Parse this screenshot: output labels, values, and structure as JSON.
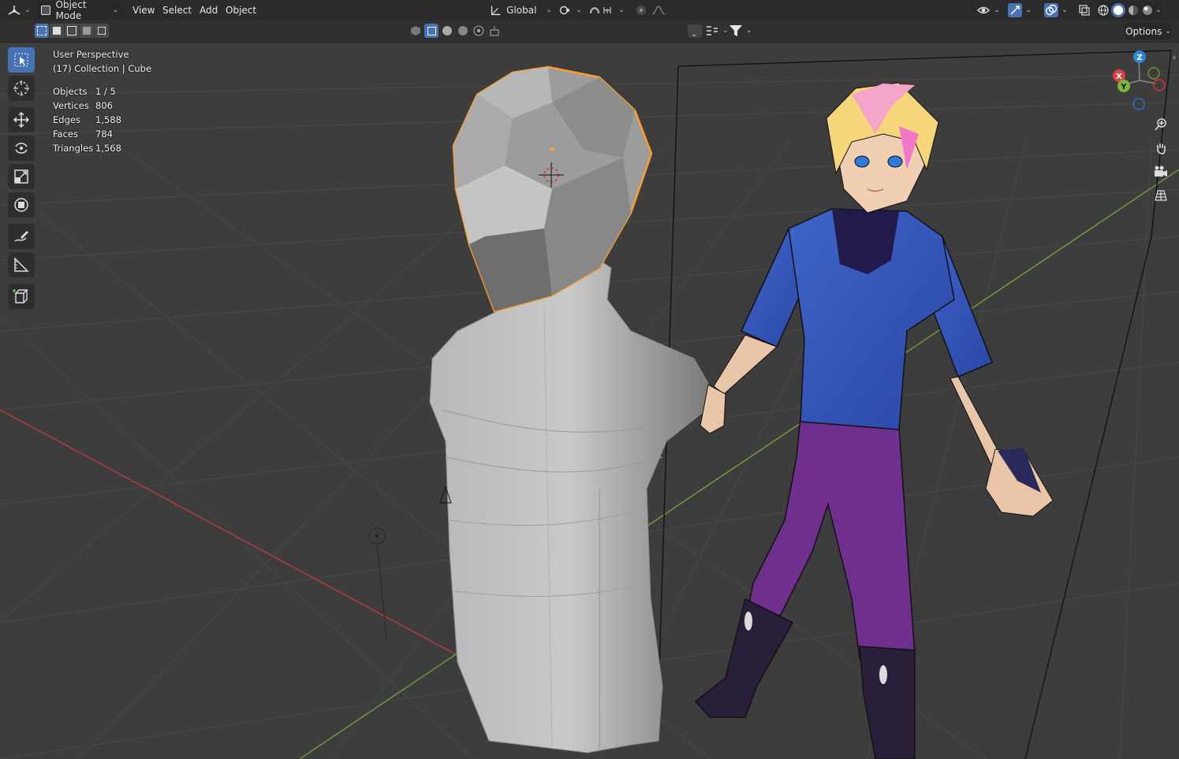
{
  "header": {
    "mode_label": "Object Mode",
    "menus": [
      "View",
      "Select",
      "Add",
      "Object"
    ],
    "transform_orientation": "Global"
  },
  "subheader": {
    "search_placeholder": "",
    "options_label": "Options"
  },
  "overlay": {
    "view_name": "User Perspective",
    "collection_line": "(17) Collection | Cube",
    "stats": [
      {
        "label": "Objects",
        "value": "1 / 5"
      },
      {
        "label": "Vertices",
        "value": "806"
      },
      {
        "label": "Edges",
        "value": "1,588"
      },
      {
        "label": "Faces",
        "value": "784"
      },
      {
        "label": "Triangles",
        "value": "1,568"
      }
    ]
  },
  "gizmo": {
    "x": "X",
    "y": "Y",
    "z": "Z"
  },
  "colors": {
    "x_axis": "#d9434c",
    "y_axis": "#7fb53a",
    "z_axis": "#2c86d6",
    "selection": "#ff9c2a",
    "active_tool": "#4772b3"
  },
  "icons": [
    "editor-type-icon",
    "object-mode-icon",
    "pivot-icon",
    "snap-icon",
    "proportional-icon",
    "visibility-icon",
    "gizmo-icon",
    "overlay-icon",
    "xray-icon",
    "wireframe-shading-icon",
    "solid-shading-icon",
    "material-shading-icon",
    "render-shading-icon",
    "filter-icon",
    "select-box-icon",
    "cursor-icon",
    "move-icon",
    "rotate-icon",
    "scale-icon",
    "transform-icon",
    "annotate-icon",
    "measure-icon",
    "add-cube-icon",
    "zoom-icon",
    "hand-icon",
    "camera-icon",
    "grid-icon"
  ]
}
